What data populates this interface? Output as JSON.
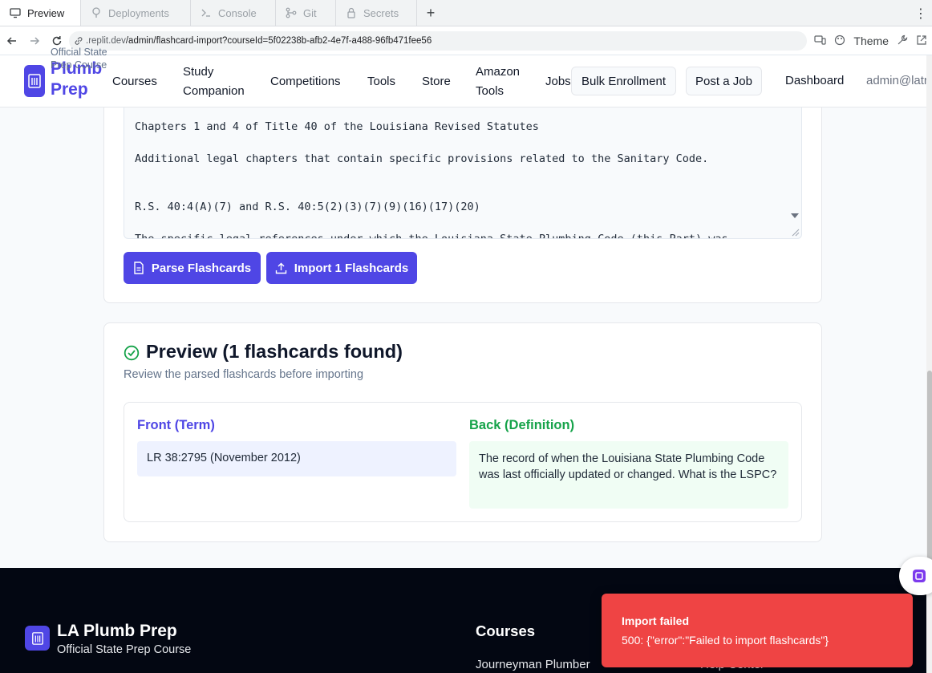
{
  "browser": {
    "tabs": [
      {
        "label": "Preview",
        "icon": "monitor-icon",
        "active": true
      },
      {
        "label": "Deployments",
        "icon": "deploy-icon",
        "active": false
      },
      {
        "label": "Console",
        "icon": "terminal-icon",
        "active": false
      },
      {
        "label": "Git",
        "icon": "git-icon",
        "active": false
      },
      {
        "label": "Secrets",
        "icon": "lock-icon",
        "active": false
      }
    ],
    "new_tab": "+",
    "url_host": ".replit.dev",
    "url_path": "/admin/flashcard-import?courseId=5f02238b-afb2-4e7f-a488-96fb471fee56",
    "theme_label": "Theme"
  },
  "header": {
    "brand_line1": "Plumb",
    "brand_line2": "Prep",
    "brand_sub_line1": "Official State",
    "brand_sub_line2": "Prep Course",
    "nav": {
      "courses": "Courses",
      "study_line1": "Study",
      "study_line2": "Companion",
      "competitions": "Competitions",
      "tools": "Tools",
      "store": "Store",
      "amazon_line1": "Amazon",
      "amazon_line2": "Tools",
      "jobs": "Jobs"
    },
    "bulk_enrollment": "Bulk Enrollment",
    "post_job": "Post a Job",
    "dashboard": "Dashboard",
    "user": "admin@latr"
  },
  "import": {
    "textarea_lines": [
      "Chapters 1 and 4 of Title 40 of the Louisiana Revised Statutes",
      "Additional legal chapters that contain specific provisions related to the Sanitary Code.",
      "R.S. 40:4(A)(7) and R.S. 40:5(2)(3)(7)(9)(16)(17)(20)",
      "The specific legal references under which the Louisiana State Plumbing Code (this Part) was"
    ],
    "parse_button": "Parse Flashcards",
    "import_button": "Import 1 Flashcards"
  },
  "preview": {
    "title": "Preview (1 flashcards found)",
    "description": "Review the parsed flashcards before importing",
    "front_label": "Front (Term)",
    "back_label": "Back (Definition)",
    "front_text": "LR 38:2795 (November 2012)",
    "back_text": "The record of when the Louisiana State Plumbing Code was last officially updated or changed. What is the LSPC?"
  },
  "footer": {
    "brand": "LA Plumb Prep",
    "subtitle": "Official State Prep Course",
    "courses_heading": "Courses",
    "course_link": "Journeyman Plumber",
    "help_link": "Help Center"
  },
  "toast": {
    "title": "Import failed",
    "message": "500: {\"error\":\"Failed to import flashcards\"}"
  },
  "colors": {
    "primary": "#4f46e5",
    "success": "#16a34a",
    "error": "#ef4444",
    "footer_bg": "#030712"
  }
}
